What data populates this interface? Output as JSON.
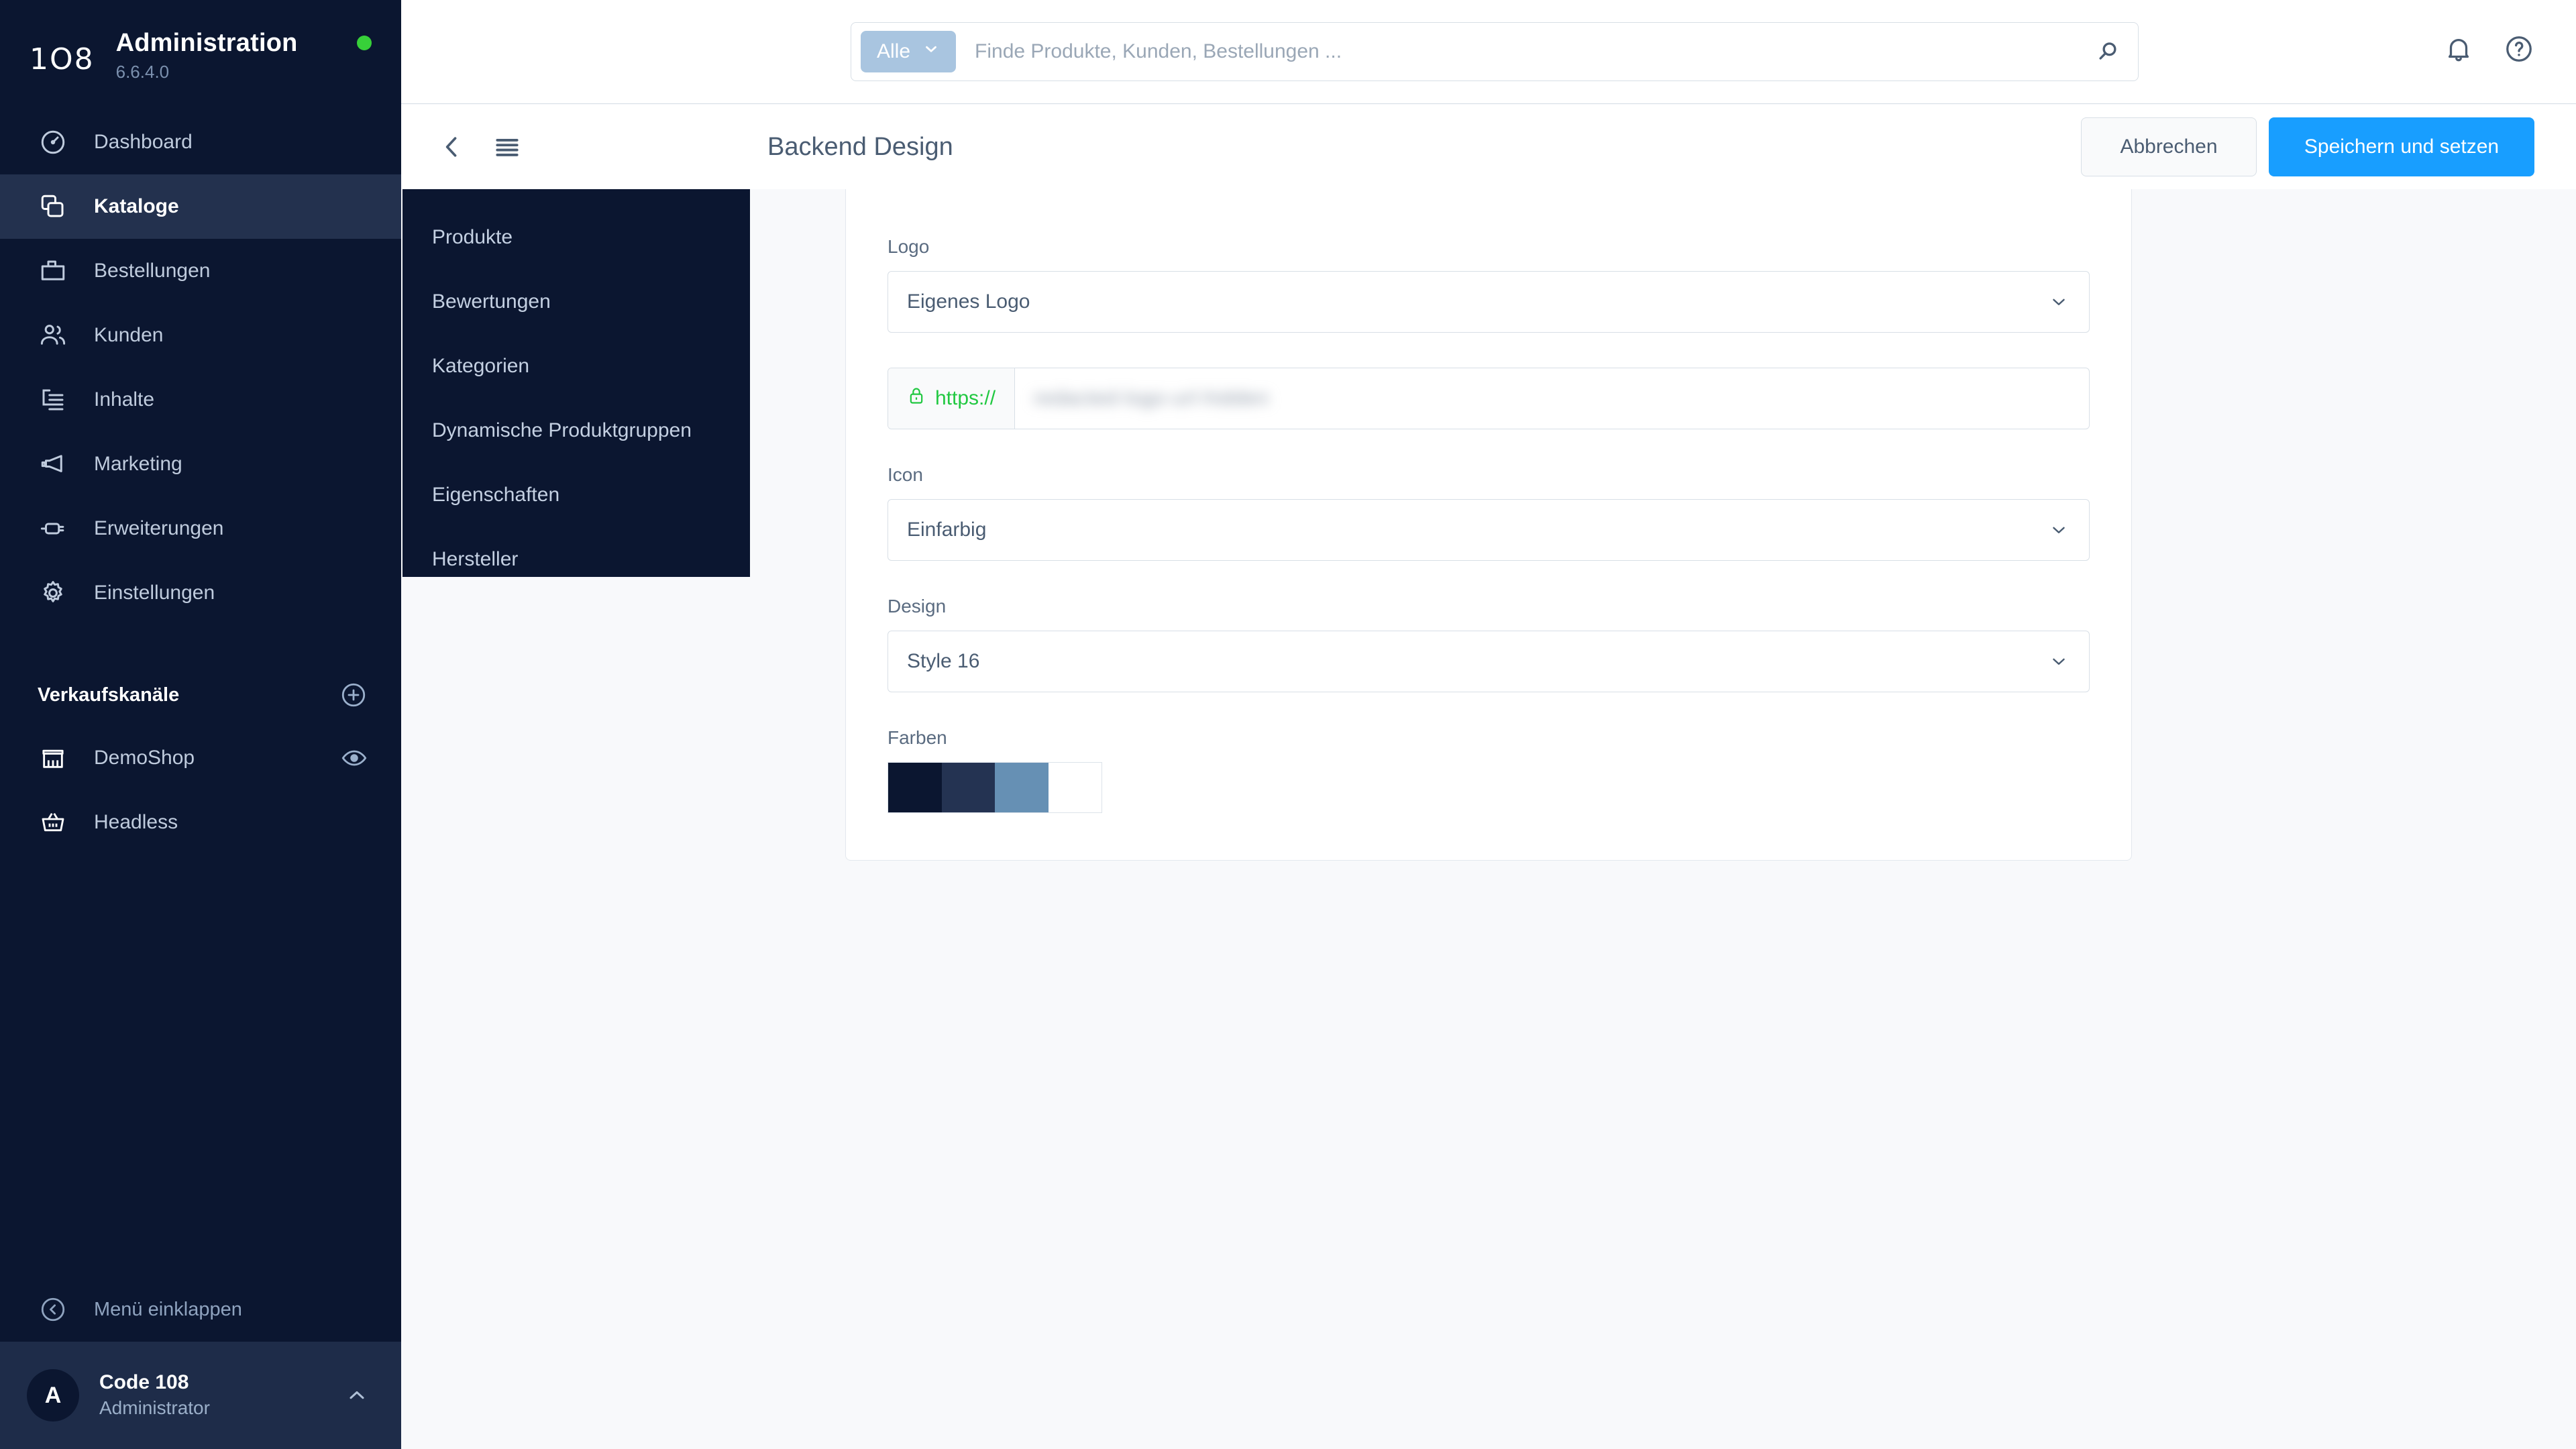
{
  "sidebar": {
    "brand": {
      "logo": "1O8",
      "title": "Administration",
      "version": "6.6.4.0",
      "status_color": "#37D039"
    },
    "nav": [
      {
        "label": "Dashboard",
        "icon": "gauge-icon",
        "active": false
      },
      {
        "label": "Kataloge",
        "icon": "catalog-icon",
        "active": true
      },
      {
        "label": "Bestellungen",
        "icon": "bag-icon",
        "active": false
      },
      {
        "label": "Kunden",
        "icon": "users-icon",
        "active": false
      },
      {
        "label": "Inhalte",
        "icon": "content-icon",
        "active": false
      },
      {
        "label": "Marketing",
        "icon": "megaphone-icon",
        "active": false
      },
      {
        "label": "Erweiterungen",
        "icon": "plug-icon",
        "active": false
      },
      {
        "label": "Einstellungen",
        "icon": "gear-icon",
        "active": false
      }
    ],
    "sales_channels": {
      "heading": "Verkaufskanäle",
      "add_label": "plus-circle-icon",
      "items": [
        {
          "label": "DemoShop",
          "icon": "store-icon",
          "trailing_icon": "eye-icon"
        },
        {
          "label": "Headless",
          "icon": "basket-icon",
          "trailing_icon": ""
        }
      ]
    },
    "collapse_label": "Menü einklappen",
    "user": {
      "initial": "A",
      "name": "Code 108",
      "role": "Administrator"
    }
  },
  "flyout": {
    "items": [
      {
        "label": "Produkte"
      },
      {
        "label": "Bewertungen"
      },
      {
        "label": "Kategorien"
      },
      {
        "label": "Dynamische Produktgruppen"
      },
      {
        "label": "Eigenschaften"
      },
      {
        "label": "Hersteller"
      }
    ]
  },
  "topbar": {
    "scope_label": "Alle",
    "search_placeholder": "Finde Produkte, Kunden, Bestellungen ...",
    "search_value": "",
    "notification_icon": "bell-icon",
    "help_icon": "help-circle-icon",
    "search_icon": "search-icon"
  },
  "content_header": {
    "back_icon": "chevron-left-icon",
    "list_icon": "list-icon",
    "title": "Backend Design",
    "cancel_label": "Abbrechen",
    "save_label": "Speichern und setzen",
    "primary_color": "#189EFF"
  },
  "form": {
    "logo": {
      "label": "Logo",
      "value": "Eigenes Logo"
    },
    "url": {
      "protocol": "https://",
      "value": "redacted-logo-url-hidden",
      "lock_color": "#21C841"
    },
    "icon": {
      "label": "Icon",
      "value": "Einfarbig"
    },
    "design": {
      "label": "Design",
      "value": "Style 16"
    },
    "colors": {
      "label": "Farben",
      "swatches": [
        "#0B1630",
        "#243352",
        "#6690B4",
        "#FFFFFF"
      ]
    }
  }
}
